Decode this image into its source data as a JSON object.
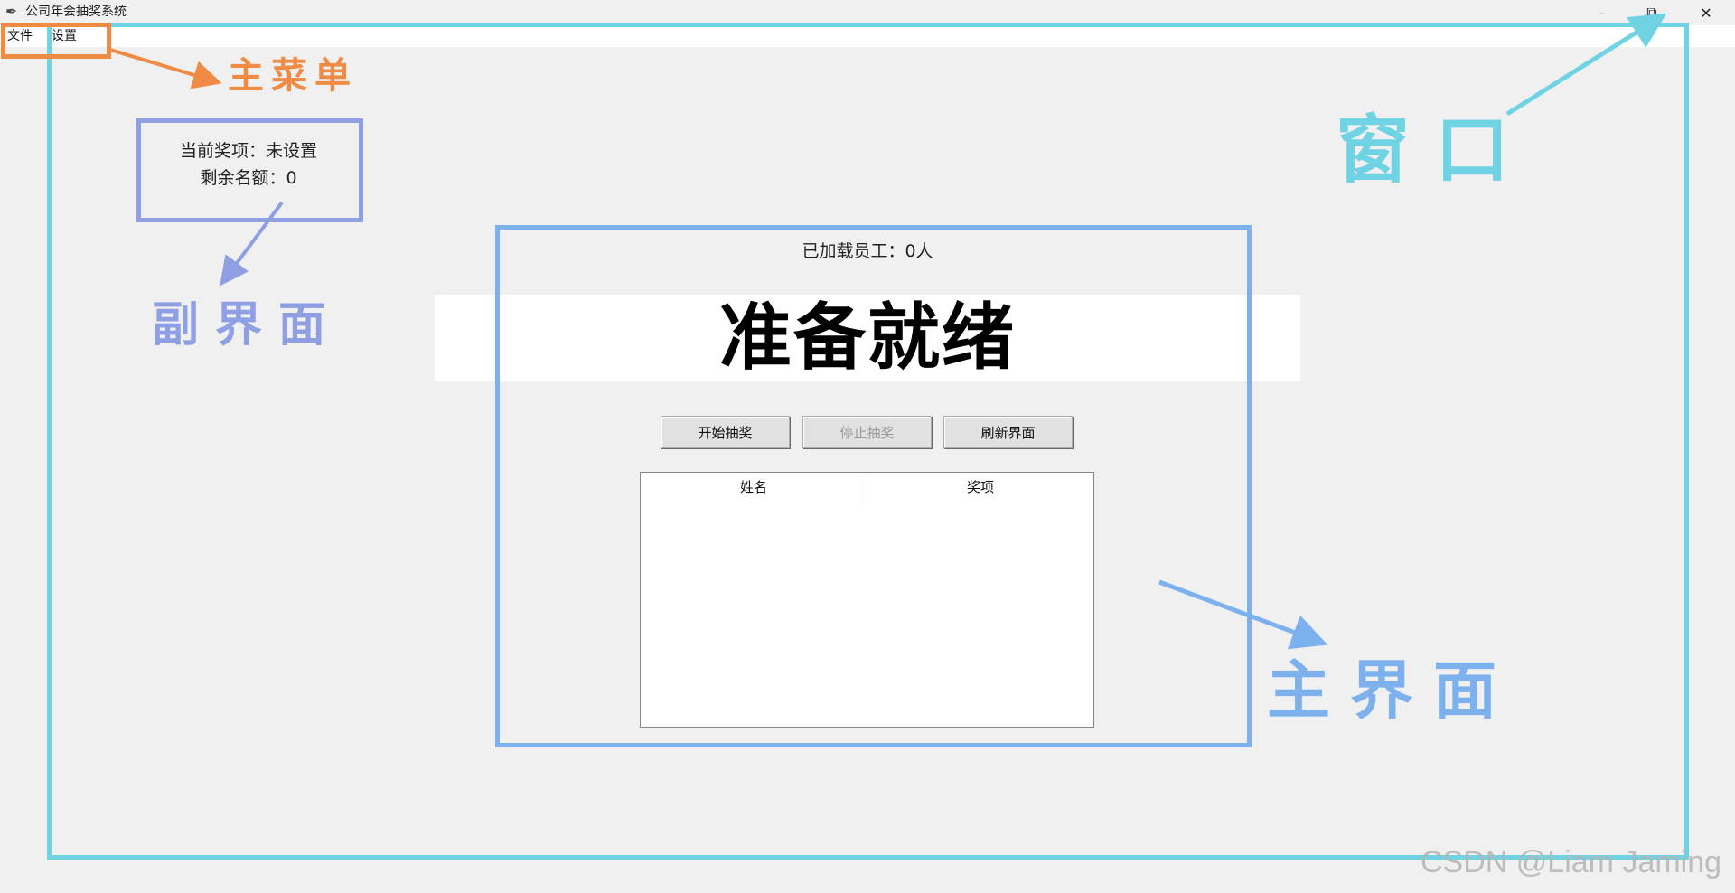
{
  "window": {
    "title": "公司年会抽奖系统",
    "app_icon": "feather-icon",
    "controls": {
      "minimize": "–",
      "restore": "⧉",
      "close": "✕"
    }
  },
  "menu": {
    "items": [
      {
        "label": "文件"
      },
      {
        "label": "设置"
      }
    ]
  },
  "info_panel": {
    "current_prize": "当前奖项：未设置",
    "remaining_quota": "剩余名额：0"
  },
  "main": {
    "employee_count": "已加载员工：0人",
    "status_text": "准备就绪",
    "buttons": {
      "start": "开始抽奖",
      "stop": "停止抽奖",
      "refresh": "刷新界面"
    },
    "table": {
      "columns": [
        "姓名",
        "奖项"
      ],
      "rows": []
    }
  },
  "annotations": {
    "main_menu": "主菜单",
    "window": "窗口",
    "sub_interface": "副界面",
    "main_interface": "主界面",
    "colors": {
      "menu": "#ef8b45",
      "window": "#6fd3e3",
      "sub": "#8e9fe3",
      "main": "#7db1ee"
    }
  },
  "watermark": "CSDN @Liam Jaming"
}
